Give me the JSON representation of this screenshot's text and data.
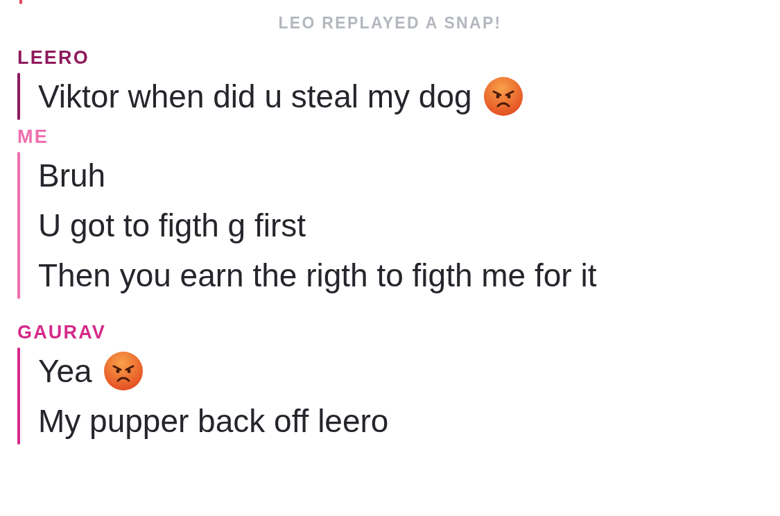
{
  "previous_message_bar": {
    "color": "#e8425a"
  },
  "notice": "LEO REPLAYED A SNAP!",
  "groups": [
    {
      "sender": "LEERO",
      "color": "#8e1a5c",
      "messages": [
        {
          "text": "Viktor when did u steal my dog",
          "kind": "angry"
        }
      ]
    },
    {
      "sender": "ME",
      "color": "#ef6fae",
      "messages": [
        {
          "text": "Bruh"
        },
        {
          "text": "U got to figth g first"
        },
        {
          "text": "Then you earn the rigth to figth me for it"
        }
      ]
    },
    {
      "sender": "GAURAV",
      "color": "#d6288a",
      "messages": [
        {
          "text": "Yea",
          "kind": "angry"
        },
        {
          "text": "My pupper back off leero"
        }
      ]
    }
  ]
}
